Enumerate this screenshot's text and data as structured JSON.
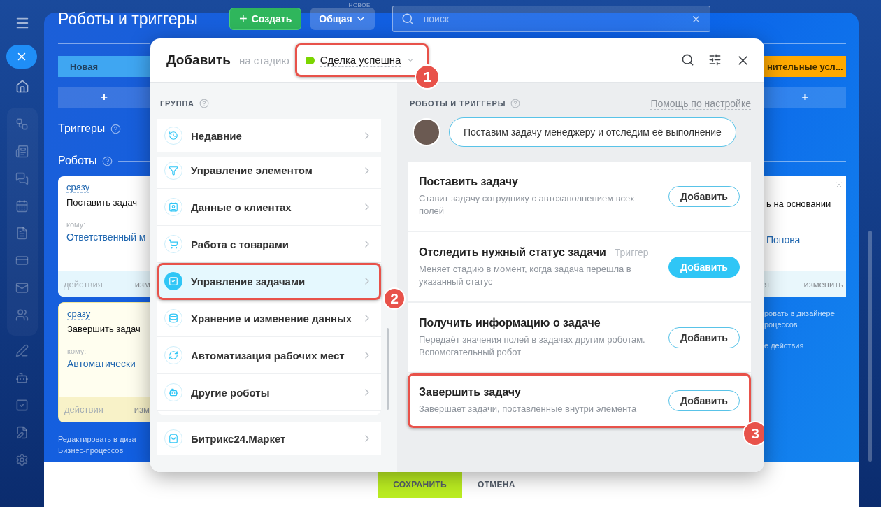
{
  "page": {
    "title": "Роботы и триггеры",
    "create_button": "Создать",
    "create_plus": "+",
    "filter": {
      "label": "Общая",
      "badge": "НОВОЕ"
    },
    "search": {
      "placeholder": "поиск"
    }
  },
  "left_column": {
    "stage": "Новая",
    "add": "+",
    "sections": [
      "Триггеры",
      "Роботы"
    ],
    "cards": [
      {
        "kind": "normal",
        "delay": "сразу",
        "title": "Поставить задач",
        "to_label": "кому:",
        "to": "Ответственный м",
        "footer_left": "действия",
        "footer_right": "изм"
      },
      {
        "kind": "highlighted",
        "delay": "сразу",
        "title": "Завершить задач",
        "to_label": "кому:",
        "to": "Автоматически",
        "footer_left": "действия",
        "footer_right": "изм"
      }
    ],
    "notes": [
      "Редактировать в диза",
      "Бизнес-процессов"
    ]
  },
  "right_column": {
    "stage": "нительные усл...",
    "add": "+",
    "card": {
      "title": "ь на основании",
      "to": "Попова",
      "footer_left": "я",
      "footer_right": "изменить"
    },
    "notes": [
      "ровать в дизайнере",
      "роцессов"
    ],
    "extra_note": "е действия"
  },
  "footer": {
    "buttons": [
      {
        "kind": "primary",
        "label": "СОХРАНИТЬ"
      },
      {
        "kind": "link",
        "label": "ОТМЕНА"
      }
    ]
  },
  "modal": {
    "title": "Добавить",
    "stage_prefix": "на стадию",
    "stage": {
      "label": "Сделка успешна",
      "color": "#7bd500",
      "callout": "1"
    },
    "group_heading": "ГРУППА",
    "group_sections": [
      {
        "items": [
          {
            "label": "Недавние",
            "selected": false
          }
        ]
      },
      {
        "items": [
          {
            "label": "Управление элементом",
            "selected": false
          },
          {
            "label": "Данные о клиентах",
            "selected": false
          },
          {
            "label": "Работа с товарами",
            "selected": false
          },
          {
            "label": "Управление задачами",
            "selected": true,
            "callout": "2"
          },
          {
            "label": "Хранение и изменение данных",
            "selected": false
          },
          {
            "label": "Автоматизация рабочих мест",
            "selected": false
          },
          {
            "label": "Другие роботы",
            "selected": false
          }
        ]
      },
      {
        "items": [
          {
            "label": "Битрикс24.Маркет",
            "selected": false
          }
        ]
      }
    ],
    "robots_heading": "РОБОТЫ И ТРИГГЕРЫ",
    "help_link": "Помощь по настройке",
    "hint": "Поставим задачу менеджеру и отследим её выполнение",
    "robots": [
      {
        "title": "Поставить задачу",
        "description": "Ставит задачу сотруднику с автозаполнением всех полей",
        "button": "Добавить",
        "highlighted": false
      },
      {
        "title": "Отследить нужный статус задачи",
        "tag": "Триггер",
        "description": "Меняет стадию в момент, когда задача перешла в указанный статус",
        "button": "Добавить",
        "highlighted": true
      },
      {
        "title": "Получить информацию о задаче",
        "description": "Передаёт значения полей в задачах другим роботам. Вспомогательный робот",
        "button": "Добавить",
        "highlighted": false
      },
      {
        "title": "Завершить задачу",
        "description": "Завершает задачи, поставленные внутри элемента",
        "button": "Добавить",
        "highlighted": false,
        "callout": "3"
      }
    ]
  }
}
